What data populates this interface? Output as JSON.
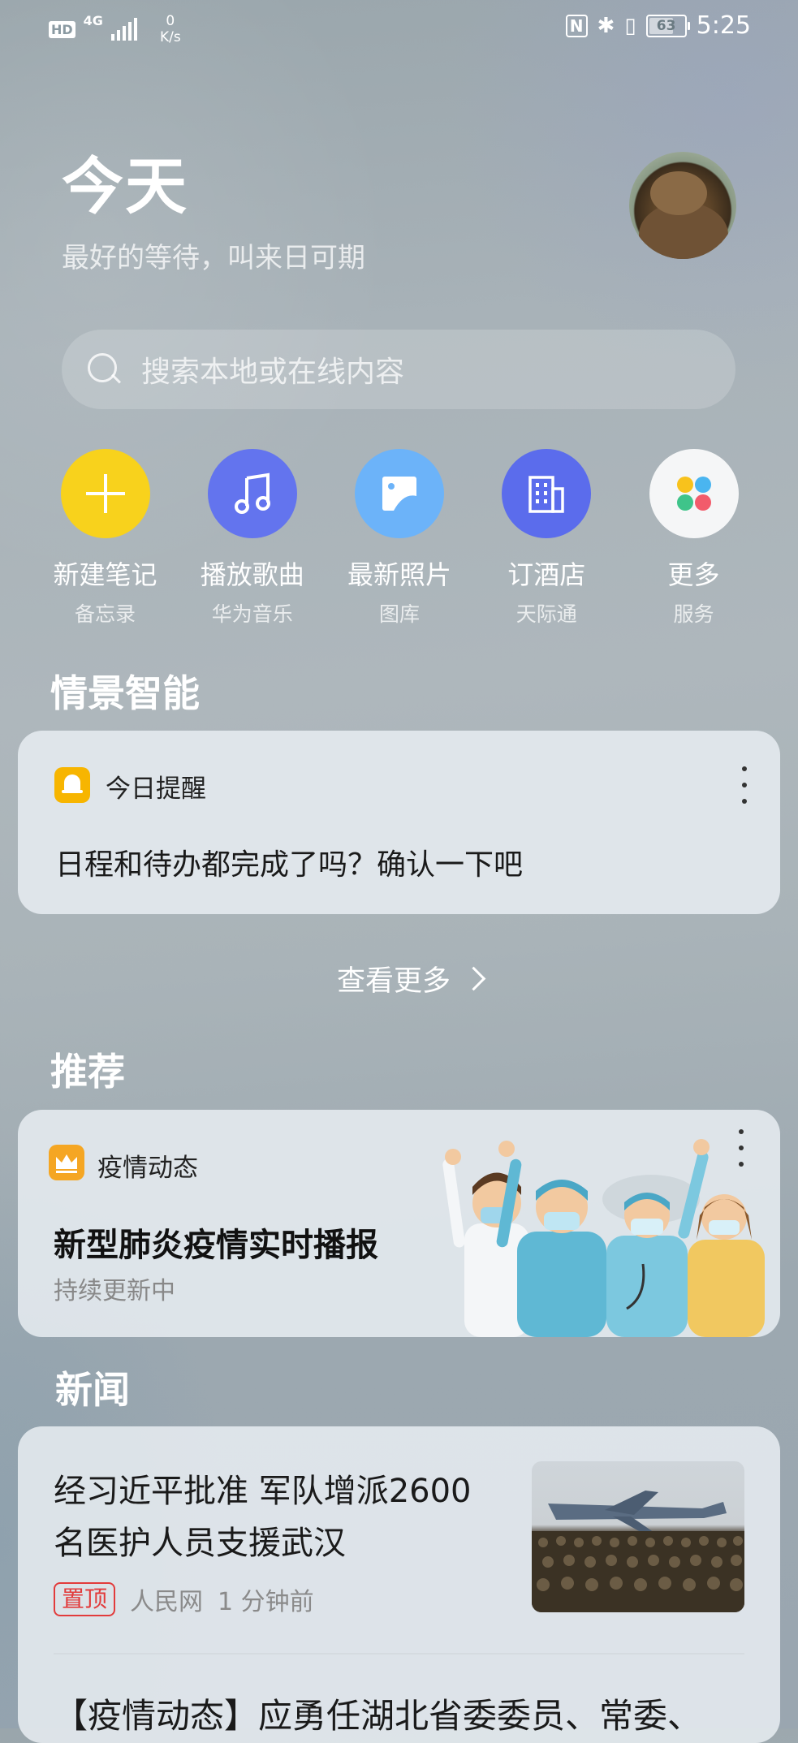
{
  "status_bar": {
    "hd": "HD",
    "network": "4G",
    "speed_value": "0",
    "speed_unit": "K/s",
    "nfc": "N",
    "battery": "63",
    "time": "5:25"
  },
  "header": {
    "title": "今天",
    "subtitle": "最好的等待，叫来日可期"
  },
  "search": {
    "placeholder": "搜索本地或在线内容"
  },
  "quick_actions": [
    {
      "label": "新建笔记",
      "sub": "备忘录",
      "icon": "plus-icon",
      "color": "#f8d21c"
    },
    {
      "label": "播放歌曲",
      "sub": "华为音乐",
      "icon": "music-note-icon",
      "color": "#6374ee"
    },
    {
      "label": "最新照片",
      "sub": "图库",
      "icon": "photo-icon",
      "color": "#6cb3f9"
    },
    {
      "label": "订酒店",
      "sub": "天际通",
      "icon": "building-icon",
      "color": "#5b6cec"
    },
    {
      "label": "更多",
      "sub": "服务",
      "icon": "apps-grid-icon",
      "color": "#f5f6f7"
    }
  ],
  "smart_section": {
    "title": "情景智能",
    "card": {
      "label": "今日提醒",
      "text": "日程和待办都完成了吗？确认一下吧"
    },
    "see_more": "查看更多"
  },
  "recommend_section": {
    "title": "推荐",
    "card": {
      "label": "疫情动态",
      "title": "新型肺炎疫情实时播报",
      "subtitle": "持续更新中"
    }
  },
  "news_section": {
    "title": "新闻",
    "items": [
      {
        "title_line1": "经习近平批准 军队增派2600",
        "title_line2": "名医护人员支援武汉",
        "badge": "置顶",
        "source": "人民网",
        "time": "1 分钟前"
      },
      {
        "title_line1": "【疫情动态】应勇任湖北省委委员、常委、"
      }
    ]
  }
}
